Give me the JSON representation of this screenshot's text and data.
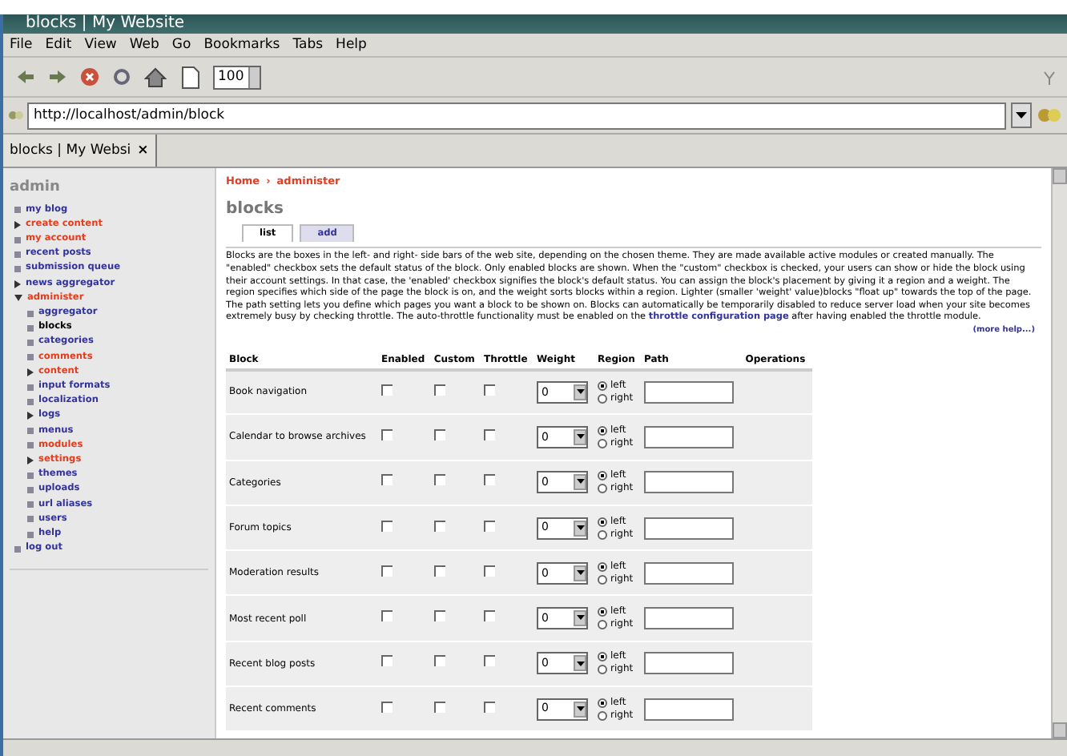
{
  "window": {
    "title": "blocks | My Website"
  },
  "menu": [
    "File",
    "Edit",
    "View",
    "Web",
    "Go",
    "Bookmarks",
    "Tabs",
    "Help"
  ],
  "toolbar": {
    "zoom": "100"
  },
  "address": {
    "value": "http://localhost/admin/block"
  },
  "tabs": [
    {
      "label": "blocks | My Websi",
      "selected": true,
      "close": "×"
    }
  ],
  "sidebar": {
    "title": "admin",
    "items": [
      {
        "label": "my blog",
        "kind": "leaf",
        "highlighted": false,
        "selected": false
      },
      {
        "label": "create content",
        "kind": "collapsed",
        "highlighted": true,
        "selected": false
      },
      {
        "label": "my account",
        "kind": "leaf",
        "highlighted": true,
        "selected": false
      },
      {
        "label": "recent posts",
        "kind": "leaf",
        "highlighted": false,
        "selected": false
      },
      {
        "label": "submission queue",
        "kind": "leaf",
        "highlighted": false,
        "selected": false
      },
      {
        "label": "news aggregator",
        "kind": "collapsed",
        "highlighted": false,
        "selected": false
      },
      {
        "label": "administer",
        "kind": "expanded",
        "highlighted": true,
        "selected": false,
        "children": [
          {
            "label": "aggregator",
            "kind": "leaf",
            "highlighted": false,
            "selected": false
          },
          {
            "label": "blocks",
            "kind": "leaf",
            "highlighted": false,
            "selected": true
          },
          {
            "label": "categories",
            "kind": "leaf",
            "highlighted": false,
            "selected": false
          },
          {
            "label": "comments",
            "kind": "leaf",
            "highlighted": true,
            "selected": false
          },
          {
            "label": "content",
            "kind": "collapsed",
            "highlighted": true,
            "selected": false
          },
          {
            "label": "input formats",
            "kind": "leaf",
            "highlighted": false,
            "selected": false
          },
          {
            "label": "localization",
            "kind": "leaf",
            "highlighted": false,
            "selected": false
          },
          {
            "label": "logs",
            "kind": "collapsed",
            "highlighted": false,
            "selected": false
          },
          {
            "label": "menus",
            "kind": "leaf",
            "highlighted": false,
            "selected": false
          },
          {
            "label": "modules",
            "kind": "leaf",
            "highlighted": true,
            "selected": false
          },
          {
            "label": "settings",
            "kind": "collapsed",
            "highlighted": true,
            "selected": false
          },
          {
            "label": "themes",
            "kind": "leaf",
            "highlighted": false,
            "selected": false
          },
          {
            "label": "uploads",
            "kind": "leaf",
            "highlighted": false,
            "selected": false
          },
          {
            "label": "url aliases",
            "kind": "leaf",
            "highlighted": false,
            "selected": false
          },
          {
            "label": "users",
            "kind": "leaf",
            "highlighted": false,
            "selected": false
          },
          {
            "label": "help",
            "kind": "leaf",
            "highlighted": false,
            "selected": false
          }
        ]
      },
      {
        "label": "log out",
        "kind": "leaf",
        "highlighted": false,
        "selected": false
      }
    ]
  },
  "breadcrumb": [
    "Home",
    "›",
    "administer"
  ],
  "page_title": "blocks",
  "page_tabs": [
    {
      "label": "list",
      "selected": true
    },
    {
      "label": "add",
      "selected": false
    }
  ],
  "description": {
    "text": "Blocks are the boxes in the left- and right- side bars of the web site, depending on the chosen theme. They are made available active modules or created manually. The \"enabled\" checkbox sets the default status of the block. Only enabled blocks are shown. When the \"custom\" checkbox is checked, your users can show or hide the block using their account settings. In that case, the 'enabled' checkbox signifies the block's default status. You can assign the block's placement by giving it a region and a weight. The region specifies which side of the page the block is on, and the weight sorts blocks within a region. Lighter (smaller 'weight' value)blocks \"float up\" towards the top of the page. The path setting lets you define which pages you want a block to be shown on. Blocks can automatically be temporarily disabled to reduce server load when your site becomes extremely busy by checking throttle. The auto-throttle functionality must be enabled on the",
    "link": "throttle configuration page",
    "after": "after having enabled the throttle module."
  },
  "more_help": "(more help...)",
  "table": {
    "columns": [
      "Block",
      "Enabled",
      "Custom",
      "Throttle",
      "Weight",
      "Region",
      "Path",
      "Operations"
    ],
    "rows": [
      {
        "block": "Book navigation",
        "enabled": false,
        "custom": false,
        "throttle": false,
        "weight": "0",
        "region": [
          {
            "label": "left",
            "selected": true
          },
          {
            "label": "right",
            "selected": false
          }
        ]
      },
      {
        "block": "Calendar to browse archives",
        "enabled": false,
        "custom": false,
        "throttle": false,
        "weight": "0",
        "region": [
          {
            "label": "left",
            "selected": true
          },
          {
            "label": "right",
            "selected": false
          }
        ]
      },
      {
        "block": "Categories",
        "enabled": false,
        "custom": false,
        "throttle": false,
        "weight": "0",
        "region": [
          {
            "label": "left",
            "selected": true
          },
          {
            "label": "right",
            "selected": false
          }
        ]
      },
      {
        "block": "Forum topics",
        "enabled": false,
        "custom": false,
        "throttle": false,
        "weight": "0",
        "region": [
          {
            "label": "left",
            "selected": true
          },
          {
            "label": "right",
            "selected": false
          }
        ]
      },
      {
        "block": "Moderation results",
        "enabled": false,
        "custom": false,
        "throttle": false,
        "weight": "0",
        "region": [
          {
            "label": "left",
            "selected": true
          },
          {
            "label": "right",
            "selected": false
          }
        ]
      },
      {
        "block": "Most recent poll",
        "enabled": false,
        "custom": false,
        "throttle": false,
        "weight": "0",
        "region": [
          {
            "label": "left",
            "selected": true
          },
          {
            "label": "right",
            "selected": false
          }
        ]
      },
      {
        "block": "Recent blog posts",
        "enabled": false,
        "custom": false,
        "throttle": false,
        "weight": "0",
        "region": [
          {
            "label": "left",
            "selected": true
          },
          {
            "label": "right",
            "selected": false
          }
        ]
      },
      {
        "block": "Recent comments",
        "enabled": false,
        "custom": false,
        "throttle": false,
        "weight": "0",
        "region": [
          {
            "label": "left",
            "selected": true
          },
          {
            "label": "right",
            "selected": false
          }
        ]
      }
    ]
  }
}
